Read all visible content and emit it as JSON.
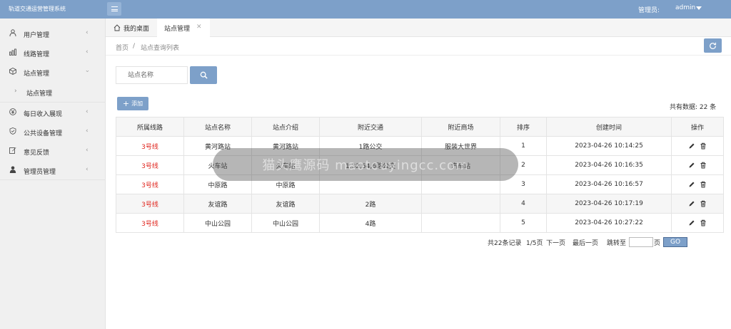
{
  "header": {
    "app_title": "轨道交通运营管理系统",
    "admin_label": "管理员:",
    "admin_name": "admin"
  },
  "sidebar": {
    "items": [
      {
        "label": "用户管理",
        "icon": "user-icon"
      },
      {
        "label": "线路管理",
        "icon": "chart-icon"
      },
      {
        "label": "站点管理",
        "icon": "cube-icon"
      },
      {
        "label": "站点管理",
        "icon": "chevron-right-icon"
      },
      {
        "label": "每日收入展现",
        "icon": "yen-icon"
      },
      {
        "label": "公共设备管理",
        "icon": "shield-icon"
      },
      {
        "label": "意见反馈",
        "icon": "edit-icon"
      },
      {
        "label": "管理员管理",
        "icon": "person-icon"
      }
    ]
  },
  "tabs": {
    "home": "我的桌面",
    "active": "站点管理"
  },
  "breadcrumb": {
    "home": "首页",
    "sep": "/",
    "current": "站点查询列表"
  },
  "search": {
    "placeholder": "站点名称"
  },
  "toolbar": {
    "add_label": "添加",
    "total_text": "共有数据: 22 条"
  },
  "table": {
    "headers": [
      "所属线路",
      "站点名称",
      "站点介绍",
      "附近交通",
      "附近商场",
      "排序",
      "创建时间",
      "操作"
    ],
    "rows": [
      {
        "route": "3号线",
        "name": "黄河路站",
        "intro": "黄河路站",
        "traffic": "1路公交",
        "mall": "服装大世界",
        "sort": "1",
        "time": "2023-04-26 10:14:25"
      },
      {
        "route": "3号线",
        "name": "火车站",
        "intro": "火车站",
        "traffic": "1,32,54,6路公交",
        "mall": "汽车站",
        "sort": "2",
        "time": "2023-04-26 10:16:35"
      },
      {
        "route": "3号线",
        "name": "中原路",
        "intro": "中原路",
        "traffic": "",
        "mall": "",
        "sort": "3",
        "time": "2023-04-26 10:16:57"
      },
      {
        "route": "3号线",
        "name": "友谊路",
        "intro": "友谊路",
        "traffic": "2路",
        "mall": "",
        "sort": "4",
        "time": "2023-04-26 10:17:19"
      },
      {
        "route": "3号线",
        "name": "中山公园",
        "intro": "中山公园",
        "traffic": "4路",
        "mall": "",
        "sort": "5",
        "time": "2023-04-26 10:27:22"
      }
    ]
  },
  "pagination": {
    "records": "共22条记录",
    "page": "1/5页",
    "next": "下一页",
    "last": "最后一页",
    "jump_to": "跳转至",
    "page_unit": "页",
    "go": "GO"
  },
  "watermark": "猫头鹰源码 maotouyingcc.com",
  "colors": {
    "accent": "#7da0c9",
    "route_red": "#e0271f"
  }
}
